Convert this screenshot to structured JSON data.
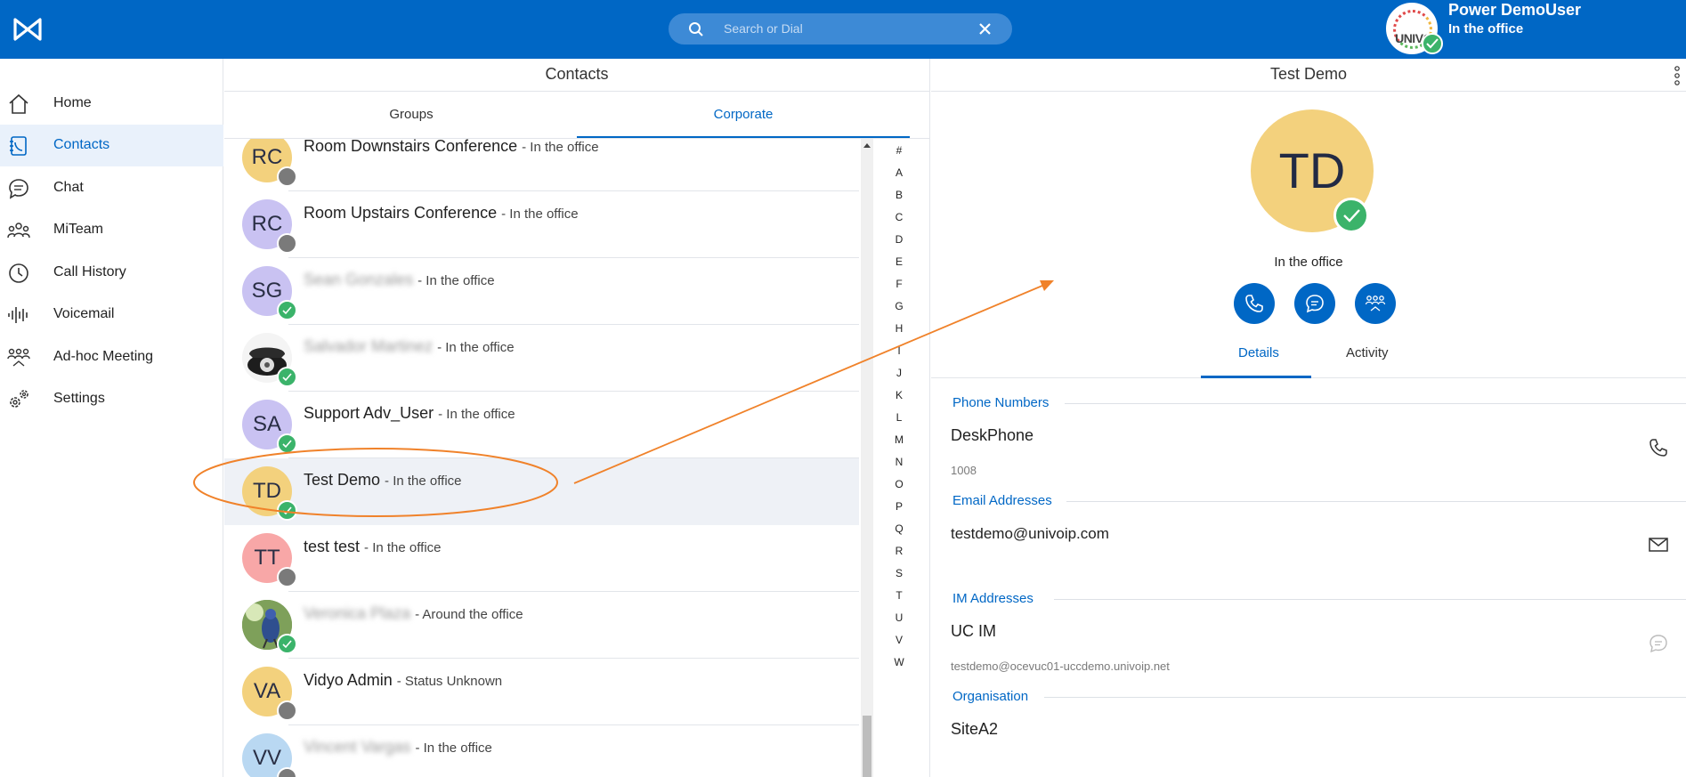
{
  "header": {
    "search_placeholder": "Search or Dial",
    "user_name": "Power DemoUser",
    "user_status": "In the office",
    "user_avatar_text": "UNIVO"
  },
  "sidebar": {
    "items": [
      {
        "label": "Home",
        "icon": "home-icon"
      },
      {
        "label": "Contacts",
        "icon": "contacts-icon",
        "active": true
      },
      {
        "label": "Chat",
        "icon": "chat-icon"
      },
      {
        "label": "MiTeam",
        "icon": "team-icon"
      },
      {
        "label": "Call History",
        "icon": "clock-icon"
      },
      {
        "label": "Voicemail",
        "icon": "voicemail-icon"
      },
      {
        "label": "Ad-hoc Meeting",
        "icon": "meeting-icon"
      },
      {
        "label": "Settings",
        "icon": "gear-icon"
      }
    ]
  },
  "contacts": {
    "title": "Contacts",
    "tabs": [
      "Groups",
      "Corporate"
    ],
    "active_tab": "Corporate",
    "list": [
      {
        "initials": "RC",
        "name": "Room Downstairs Conference",
        "status": "- In the office",
        "presence": "offline",
        "color": "#f3d17d"
      },
      {
        "initials": "RC",
        "name": "Room Upstairs Conference",
        "status": "- In the office",
        "presence": "offline",
        "color": "#c9c2f2"
      },
      {
        "initials": "SG",
        "name": "Sean Gonzales",
        "status": "- In the office",
        "presence": "available",
        "color": "#c9c2f2",
        "blurred": true
      },
      {
        "initials": "",
        "name": "Salvador Martinez",
        "status": "- In the office",
        "presence": "available",
        "photo": "phone",
        "blurred": true
      },
      {
        "initials": "SA",
        "name": "Support Adv_User",
        "status": "- In the office",
        "presence": "available",
        "color": "#c9c2f2"
      },
      {
        "initials": "TD",
        "name": "Test Demo",
        "status": "- In the office",
        "presence": "available",
        "color": "#f3d17d",
        "selected": true
      },
      {
        "initials": "TT",
        "name": "test test",
        "status": "- In the office",
        "presence": "offline",
        "color": "#f8a7a7"
      },
      {
        "initials": "",
        "name": "Veronica Plaza",
        "status": "- Around the office",
        "presence": "available",
        "photo": "bird",
        "blurred": true
      },
      {
        "initials": "VA",
        "name": "Vidyo Admin",
        "status": "- Status Unknown",
        "presence": "offline",
        "color": "#f3d17d"
      },
      {
        "initials": "VV",
        "name": "Vincent Vargas",
        "status": "- In the office",
        "presence": "offline",
        "color": "#b9d8f2",
        "blurred": true
      }
    ],
    "alphabet": [
      "#",
      "A",
      "B",
      "C",
      "D",
      "E",
      "F",
      "G",
      "H",
      "I",
      "J",
      "K",
      "L",
      "M",
      "N",
      "O",
      "P",
      "Q",
      "R",
      "S",
      "T",
      "U",
      "V",
      "W"
    ]
  },
  "details": {
    "title": "Test Demo",
    "initials": "TD",
    "status": "In the office",
    "tabs": [
      "Details",
      "Activity"
    ],
    "active_tab": "Details",
    "sections": {
      "phone": {
        "heading": "Phone Numbers",
        "label": "DeskPhone",
        "value": "1008"
      },
      "email": {
        "heading": "Email Addresses",
        "value": "testdemo@univoip.com"
      },
      "im": {
        "heading": "IM Addresses",
        "label": "UC IM",
        "value": "testdemo@ocevuc01-uccdemo.univoip.net"
      },
      "org": {
        "heading": "Organisation",
        "value": "SiteA2"
      }
    }
  },
  "colors": {
    "brand": "#0067c5",
    "presence_available": "#3bb36a",
    "presence_offline": "#7a7a7a",
    "annotation": "#f0822a"
  }
}
